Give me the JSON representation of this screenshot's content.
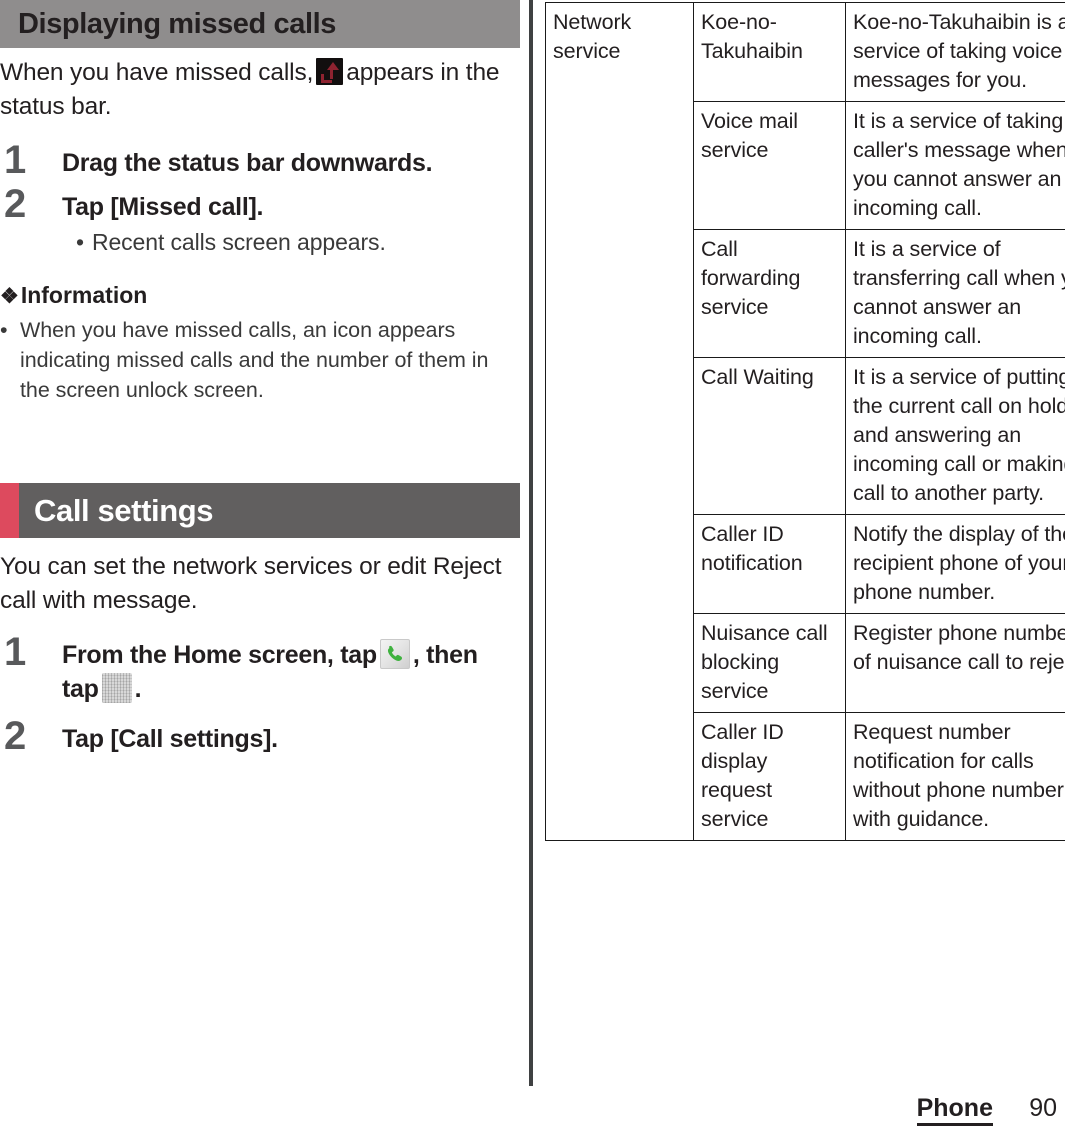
{
  "document": {
    "left_column": {
      "section1": {
        "heading": "Displaying missed calls",
        "intro_before_icon": "When you have missed calls,",
        "intro_after_icon": "appears in the status bar.",
        "steps": [
          {
            "number": "1",
            "text": "Drag the status bar downwards.",
            "sub": []
          },
          {
            "number": "2",
            "text": "Tap [Missed call].",
            "sub": [
              "Recent calls screen appears."
            ]
          }
        ],
        "information": {
          "label": "Information",
          "diamond": "❖",
          "items": [
            "When you have missed calls, an icon appears indicating missed calls and the number of them in the screen unlock screen."
          ]
        }
      },
      "section2": {
        "heading": "Call settings",
        "intro": "You can set the network services or edit Reject call with message.",
        "steps": [
          {
            "number": "1",
            "text_part1": "From the Home screen, tap",
            "text_part2": ", then tap",
            "text_part3": ".",
            "icons": [
              "phone-app-icon",
              "app-grid-icon"
            ]
          },
          {
            "number": "2",
            "text": "Tap [Call settings]."
          }
        ]
      }
    },
    "right_column": {
      "table": {
        "rows": [
          {
            "category": "Network service",
            "name": "Koe-no-Takuhaibin",
            "description": "Koe-no-Takuhaibin is a service of taking voice messages for you."
          },
          {
            "category": "",
            "name": "Voice mail service",
            "description": "It is a service of taking caller's message when you cannot answer an incoming call."
          },
          {
            "category": "",
            "name": "Call forwarding service",
            "description": "It is a service of transferring call when you cannot answer an incoming call."
          },
          {
            "category": "",
            "name": "Call Waiting",
            "description": "It is a service of putting the current call on hold and answering an incoming call or making a call to another party."
          },
          {
            "category": "",
            "name": "Caller ID notification",
            "description": "Notify the display of the recipient phone of your phone number."
          },
          {
            "category": "",
            "name": "Nuisance call blocking service",
            "description": "Register phone numbers of nuisance call to reject."
          },
          {
            "category": "",
            "name": "Caller ID display request service",
            "description": "Request number notification for calls without phone number with guidance."
          }
        ]
      }
    },
    "footer": {
      "chapter": "Phone",
      "page_number": "90"
    },
    "colors": {
      "heading_plain_bg": "#8f8d8d",
      "heading_accent_bg": "#615f5f",
      "accent_red": "#dd4a5e",
      "text": "#231f20",
      "step_number": "#58595b",
      "divider": "#3f4142",
      "phone_icon_green": "#3fb23f",
      "missed_call_red": "#8e2330"
    }
  }
}
